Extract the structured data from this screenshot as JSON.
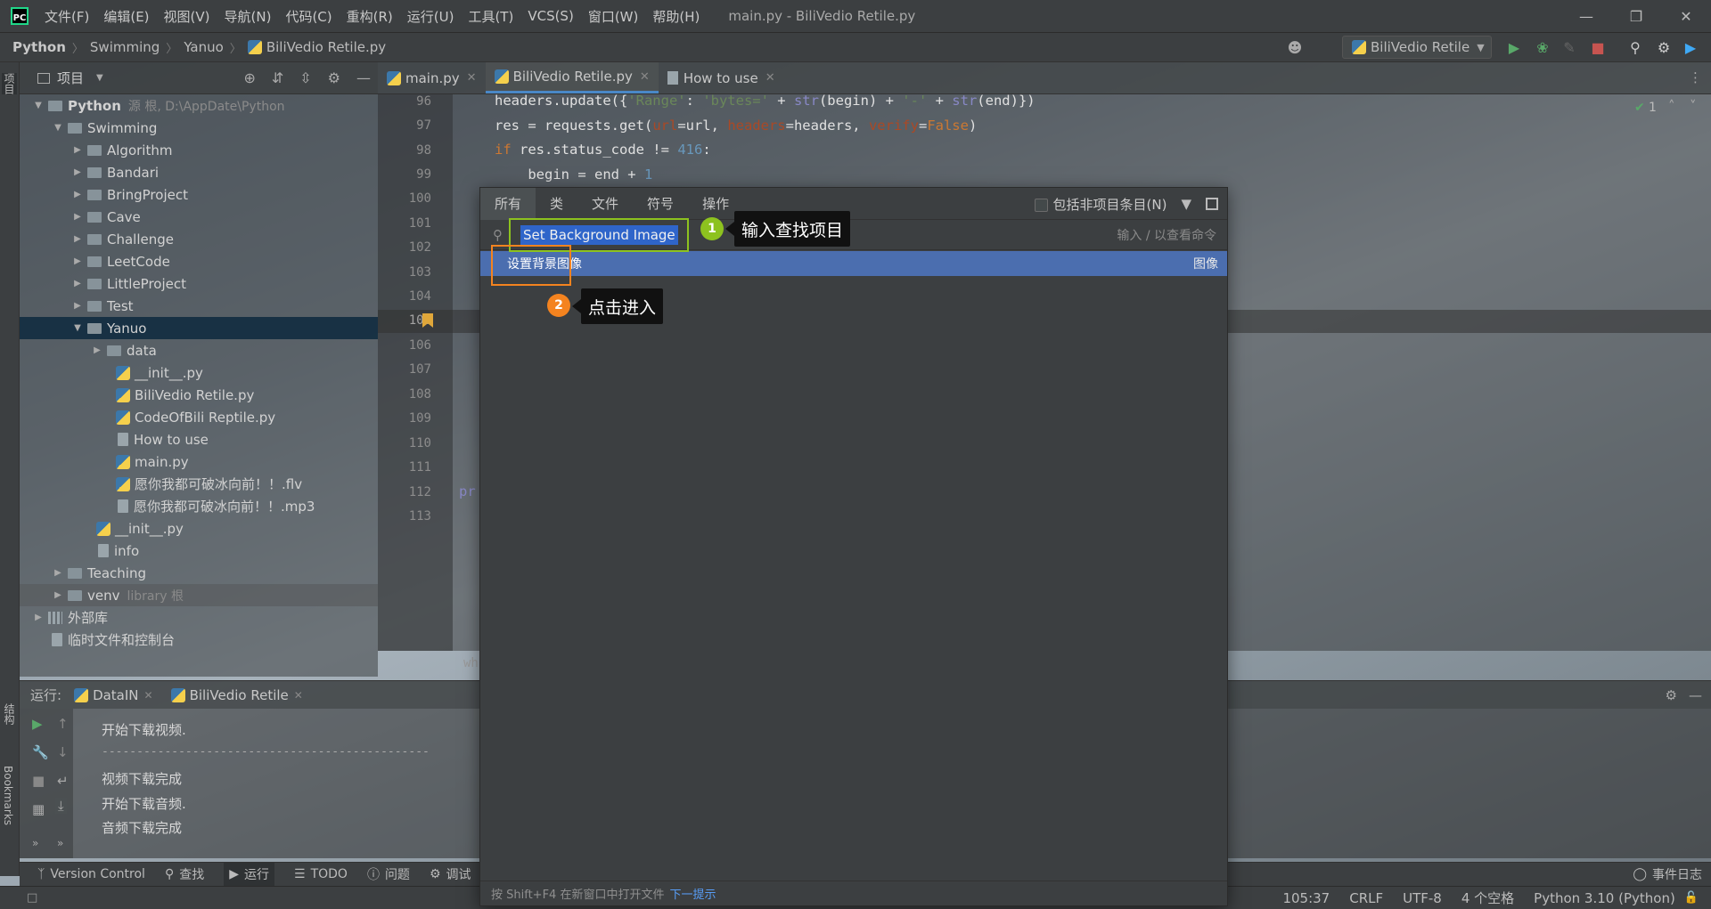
{
  "titlebar": {
    "menu": [
      "文件(F)",
      "编辑(E)",
      "视图(V)",
      "导航(N)",
      "代码(C)",
      "重构(R)",
      "运行(U)",
      "工具(T)",
      "VCS(S)",
      "窗口(W)",
      "帮助(H)"
    ],
    "window_title": "main.py - BiliVedio Retile.py"
  },
  "breadcrumb": [
    "Python",
    "Swimming",
    "Yanuo",
    "BiliVedio Retile.py"
  ],
  "run_config": {
    "label": "BiliVedio Retile"
  },
  "left_strip": {
    "project_tab": "项目",
    "structure_tab": "结构",
    "bookmarks_tab": "Bookmarks"
  },
  "project": {
    "title": "项目",
    "tree": [
      {
        "label": "Python",
        "hint": "源 根, D:\\AppDate\\Python"
      },
      {
        "label": "Swimming"
      },
      {
        "label": "Algorithm"
      },
      {
        "label": "Bandari"
      },
      {
        "label": "BringProject"
      },
      {
        "label": "Cave"
      },
      {
        "label": "Challenge"
      },
      {
        "label": "LeetCode"
      },
      {
        "label": "LittleProject"
      },
      {
        "label": "Test"
      },
      {
        "label": "Yanuo"
      },
      {
        "label": "data"
      },
      {
        "label": "__init__.py"
      },
      {
        "label": "BiliVedio Retile.py"
      },
      {
        "label": "CodeOfBili Reptile.py"
      },
      {
        "label": "How to use"
      },
      {
        "label": "main.py"
      },
      {
        "label": "愿你我都可破冰向前！！.flv"
      },
      {
        "label": "愿你我都可破冰向前！！.mp3"
      },
      {
        "label": "__init__.py"
      },
      {
        "label": "info"
      },
      {
        "label": "Teaching"
      },
      {
        "label": "venv",
        "hint": "library 根"
      },
      {
        "label": "外部库"
      },
      {
        "label": "临时文件和控制台"
      }
    ]
  },
  "editor": {
    "tabs": [
      {
        "label": "main.py"
      },
      {
        "label": "BiliVedio Retile.py"
      },
      {
        "label": "How to use"
      }
    ],
    "line_numbers": [
      "96",
      "97",
      "98",
      "99",
      "100",
      "101",
      "102",
      "103",
      "104",
      "105",
      "106",
      "107",
      "108",
      "109",
      "110",
      "111",
      "112",
      "113"
    ],
    "inspection_count": "1",
    "code": {
      "l96_a": "headers.update({",
      "l96_b": "'Range'",
      "l96_c": ": ",
      "l96_d": "'bytes='",
      "l96_e": " + ",
      "l96_f": "str",
      "l96_g": "(begin) + ",
      "l96_h": "'-'",
      "l96_i": " + ",
      "l96_j": "str",
      "l96_k": "(end)})",
      "l97_a": "res = requests.get(",
      "l97_b": "url",
      "l97_c": "=url, ",
      "l97_d": "headers",
      "l97_e": "=headers, ",
      "l97_f": "verify",
      "l97_g": "=",
      "l97_h": "False",
      "l97_i": ")",
      "l98_a": "if",
      "l98_b": " res.status_code != ",
      "l98_c": "416",
      "l98_d": ":",
      "l99_a": "    begin = end + ",
      "l99_b": "1",
      "l112": "pr",
      "bottom_crumb": "wh"
    }
  },
  "search_popup": {
    "tabs": [
      "所有",
      "类",
      "文件",
      "符号",
      "操作"
    ],
    "include_non_project": "包括非项目条目(N)",
    "query": "Set Background Image",
    "hint": "输入 / 以查看命令",
    "result": {
      "label": "设置背景图像",
      "category": "图像"
    },
    "footer": "按 Shift+F4 在新窗口中打开文件",
    "footer_link": "下一提示"
  },
  "annotations": {
    "step1_number": "1",
    "step1_text": "输入查找项目",
    "step2_number": "2",
    "step2_text": "点击进入",
    "colors": {
      "green": "#8dc21f",
      "orange": "#f4831f"
    }
  },
  "run_panel": {
    "label": "运行:",
    "tabs": [
      "DataIN",
      "BiliVedio Retile"
    ],
    "output": [
      "开始下载视频.",
      "-----------------------------------------------",
      "视频下载完成",
      "开始下载音频.",
      "音频下载完成"
    ]
  },
  "bottom_tabs": [
    "Version Control",
    "查找",
    "运行",
    "TODO",
    "问题",
    "调试"
  ],
  "event_log": "事件日志",
  "status": {
    "position": "105:37",
    "line_sep": "CRLF",
    "encoding": "UTF-8",
    "indent": "4 个空格",
    "interpreter": "Python 3.10 (Python)"
  }
}
